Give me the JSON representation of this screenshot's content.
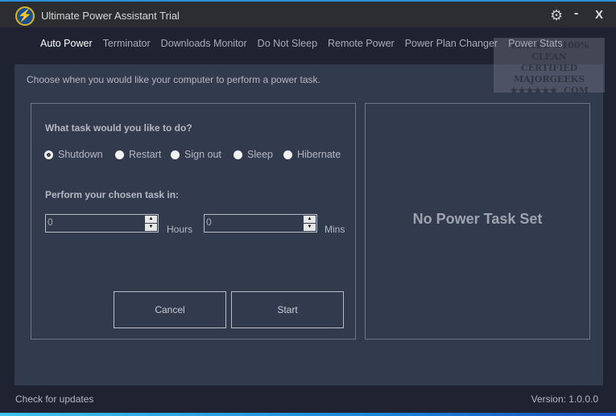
{
  "window": {
    "title": "Ultimate Power Assistant Trial",
    "accent": "#2a8fd8"
  },
  "nav": {
    "items": [
      {
        "label": "Auto Power"
      },
      {
        "label": "Terminator"
      },
      {
        "label": "Downloads Monitor"
      },
      {
        "label": "Do Not Sleep"
      },
      {
        "label": "Remote Power"
      },
      {
        "label": "Power Plan Changer"
      },
      {
        "label": "Power Stats"
      }
    ],
    "active": "Auto Power"
  },
  "main": {
    "intro": "Choose when you would like your computer to perform a power task.",
    "task_question": "What task would you like to do?",
    "tasks": [
      {
        "label": "Shutdown",
        "selected": true
      },
      {
        "label": "Restart",
        "selected": false
      },
      {
        "label": "Sign out",
        "selected": false
      },
      {
        "label": "Sleep",
        "selected": false
      },
      {
        "label": "Hibernate",
        "selected": false
      }
    ],
    "time_label": "Perform your chosen task in:",
    "hours": {
      "value": "0",
      "unit": "Hours"
    },
    "mins": {
      "value": "0",
      "unit": "Mins"
    },
    "cancel_label": "Cancel",
    "start_label": "Start",
    "status": "No Power Task Set"
  },
  "footer": {
    "updates": "Check for updates",
    "version": "Version: 1.0.0.0"
  },
  "watermark": {
    "line1": "TESTED ★100% CLEAN",
    "line2": "CERTIFIED",
    "line3": "MAJORGEEKS",
    "line4": "★★★★★★ .COM"
  }
}
